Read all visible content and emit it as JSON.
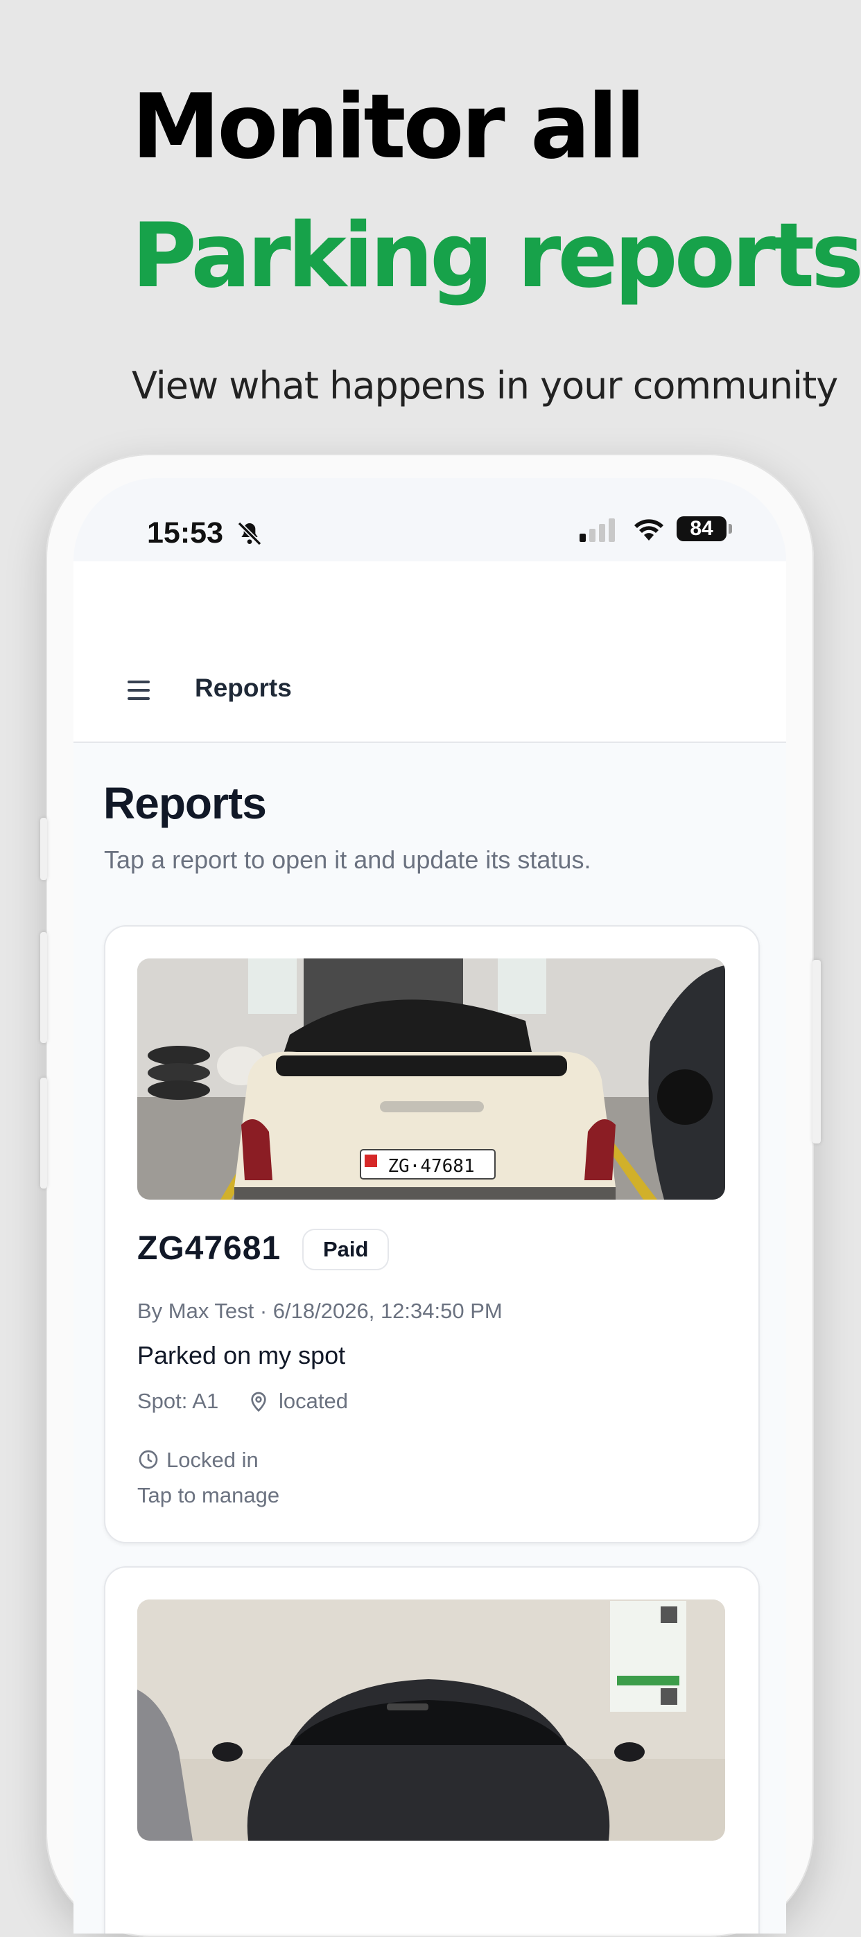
{
  "hero": {
    "line1": "Monitor all",
    "line2": "Parking reports",
    "line2_dot": ".",
    "subtitle": "View what happens in your community",
    "accent_color": "#17a24a"
  },
  "status_bar": {
    "time": "15:53",
    "silent_icon": "bell-slash-icon",
    "signal_icon": "cellular-signal-icon",
    "wifi_icon": "wifi-icon",
    "battery": "84"
  },
  "topbar": {
    "menu_icon": "hamburger-menu-icon",
    "title": "Reports"
  },
  "page": {
    "title": "Reports",
    "subtitle": "Tap a report to open it and update its status."
  },
  "reports": [
    {
      "plate": "ZG47681",
      "status": "Paid",
      "meta": "By Max Test · 6/18/2026, 12:34:50 PM",
      "description": "Parked on my spot",
      "spot": "Spot: A1",
      "location": "located",
      "lock_state": "Locked in",
      "action_hint": "Tap to manage",
      "photo_plate": "ZG·47681"
    },
    {
      "photo": "dark-sedan-photo"
    }
  ]
}
